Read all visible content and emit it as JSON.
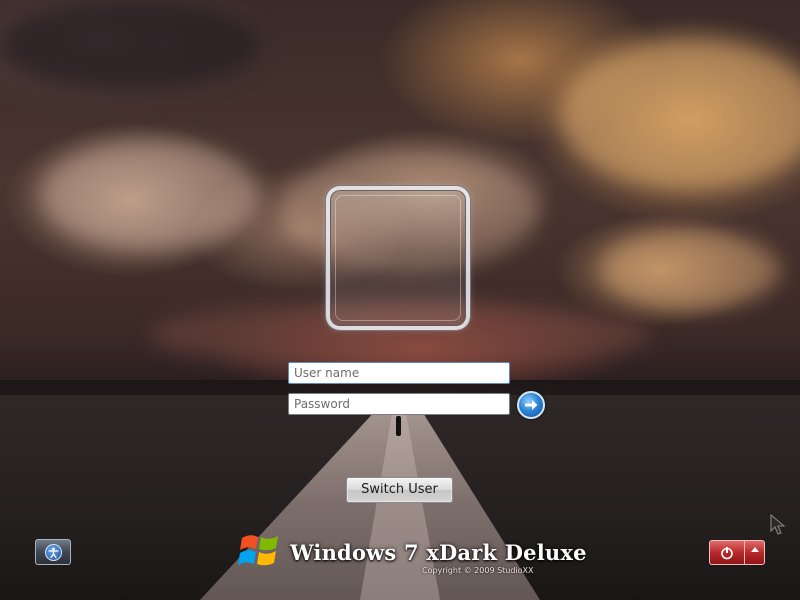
{
  "login": {
    "username_placeholder": "User name",
    "password_placeholder": "Password"
  },
  "switch_user_label": "Switch User",
  "branding": {
    "title": "Windows 7 xDark Deluxe",
    "copyright": "Copyright © 2009 StudioXX"
  },
  "icons": {
    "submit": "arrow-right-icon",
    "ease_of_access": "ease-of-access-icon",
    "shutdown": "power-icon",
    "shutdown_options": "chevron-up-icon",
    "logo": "windows-logo-icon"
  },
  "colors": {
    "accent_blue": "#2e86d6",
    "shutdown_red": "#b92a2a"
  }
}
